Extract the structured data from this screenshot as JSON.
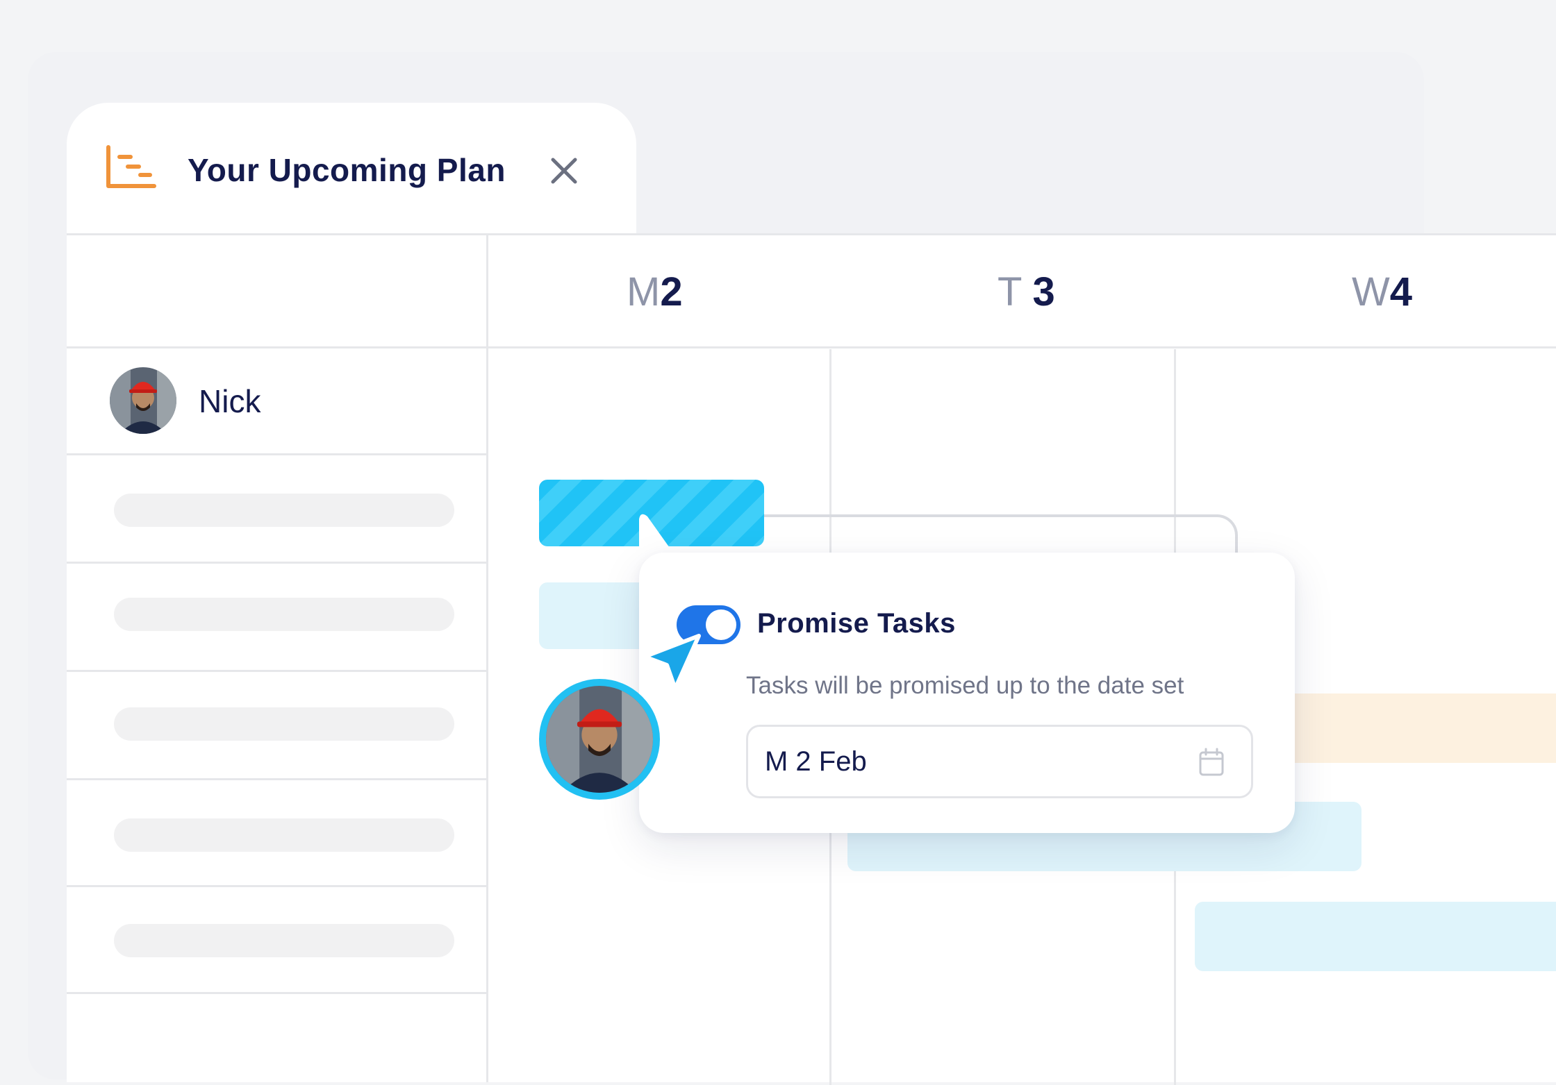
{
  "window": {
    "title": "Your Upcoming Plan",
    "icon": "gantt-plan-icon",
    "close_icon": "close-icon"
  },
  "calendar": {
    "days": [
      {
        "letter": "M",
        "number": "2"
      },
      {
        "letter": "T",
        "number": "3"
      },
      {
        "letter": "W",
        "number": "4"
      }
    ]
  },
  "resource": {
    "name": "Nick",
    "avatar": "worker-avatar"
  },
  "popover": {
    "toggle_label": "Promise Tasks",
    "toggle_on": true,
    "description": "Tasks will be promised up to the date set",
    "date_value": "M 2 Feb",
    "date_icon": "calendar-icon"
  },
  "colors": {
    "accent": "#1f75e8",
    "task_primary": "#20c3f6",
    "task_light": "#dff4fb",
    "task_orange": "#fdf1e0",
    "brand_orange": "#f0933a",
    "text_dark": "#141b4d",
    "text_muted": "#8e94a8"
  }
}
